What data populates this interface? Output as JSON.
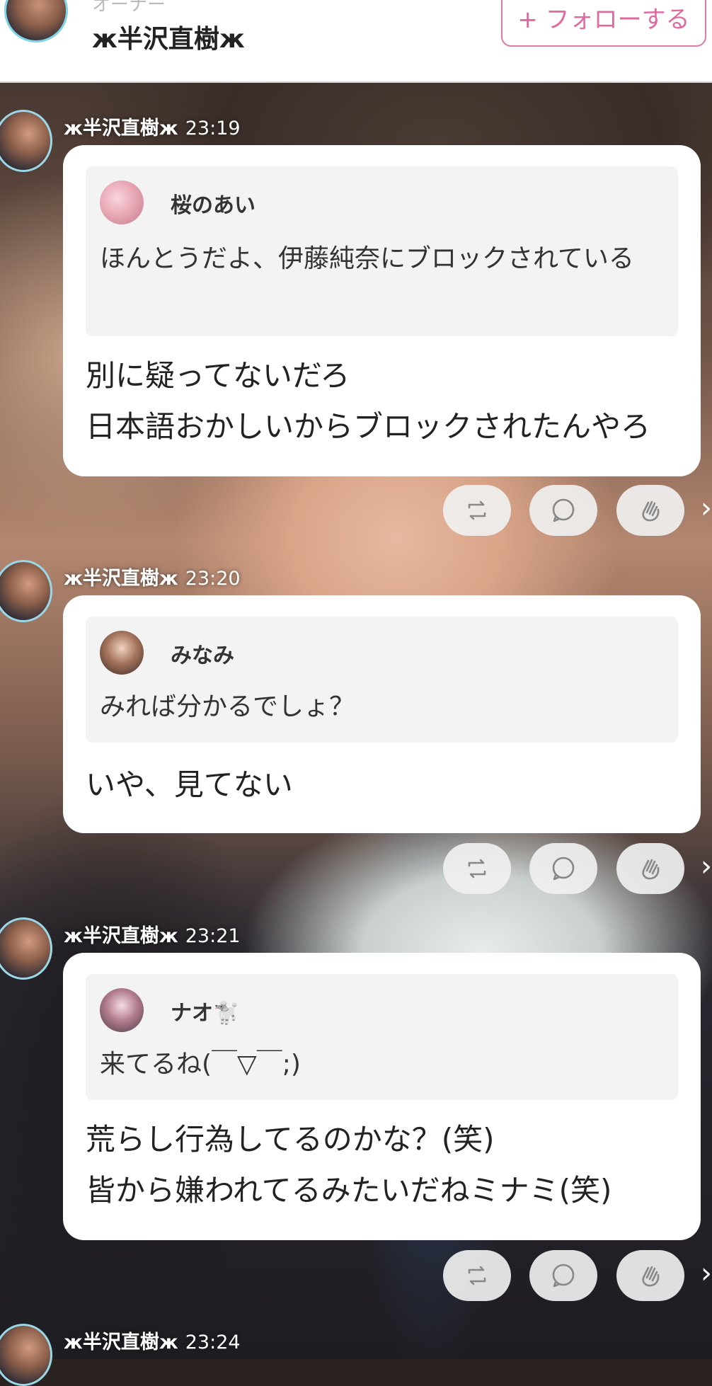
{
  "header": {
    "subtitle": "オーナー",
    "title": "ж半沢直樹ж",
    "follow_label": "+ フォローする"
  },
  "posts": [
    {
      "author": "ж半沢直樹ж",
      "time": "23:19",
      "quote": {
        "name": "桜のあい",
        "text": "ほんとうだよ、伊藤純奈にブロックされている"
      },
      "text": "別に疑ってないだろ\n日本語おかしいからブロックされたんやろ"
    },
    {
      "author": "ж半沢直樹ж",
      "time": "23:20",
      "quote": {
        "name": "みなみ",
        "text": "みれば分かるでしょ？"
      },
      "text": "いや、見てない"
    },
    {
      "author": "ж半沢直樹ж",
      "time": "23:21",
      "quote": {
        "name": "ナオ🐩",
        "text": "来てるね(￣▽￣;)"
      },
      "text": "荒らし行為してるのかな？(笑)\n皆から嫌われてるみたいだねミナミ(笑)"
    },
    {
      "author": "ж半沢直樹ж",
      "time": "23:24"
    }
  ],
  "icons": {
    "repost": "repost-icon",
    "comment": "comment-icon",
    "clap": "clap-icon",
    "more": "chevron-right-icon"
  },
  "colors": {
    "follow_accent": "#e06aa0",
    "avatar_ring": "#9ad8e8"
  }
}
